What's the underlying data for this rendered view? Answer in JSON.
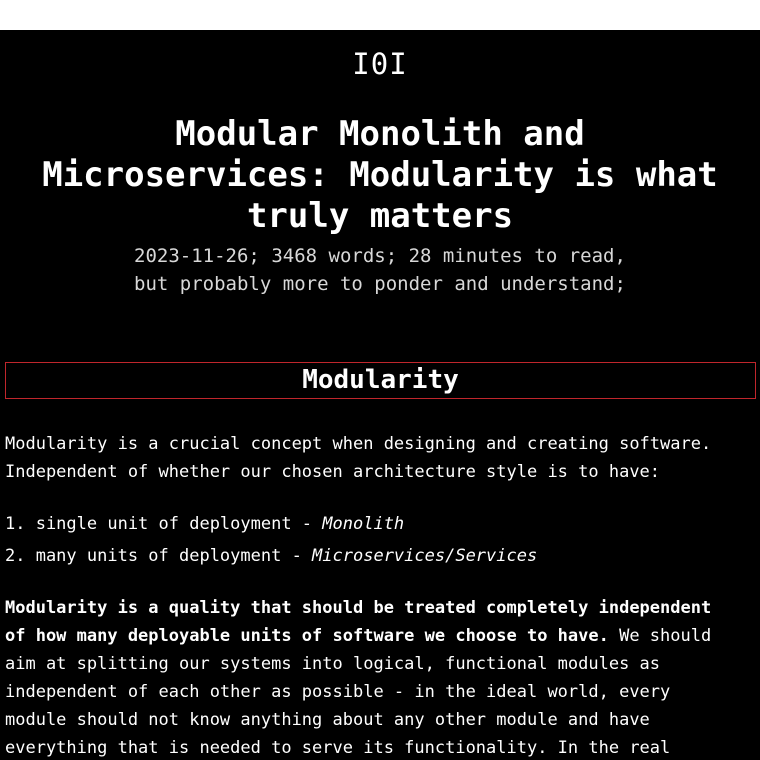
{
  "site": {
    "logo": "I0I"
  },
  "article": {
    "title_lines": [
      "Modular Monolith and",
      "Microservices: Modularity is what",
      "truly matters"
    ],
    "meta_line1": "2023-11-26; 3468 words; 28 minutes to read,",
    "meta_line2": "but probably more to ponder and understand;",
    "section_heading": "Modularity",
    "p1_line1": "Modularity is a crucial concept when designing and creating software.",
    "p1_line2": "Independent of whether our chosen architecture style is to have:",
    "list": [
      {
        "text": "1. single unit of deployment - ",
        "emphasis": "Monolith"
      },
      {
        "text": "2. many units of deployment - ",
        "emphasis": "Microservices/Services"
      }
    ],
    "p2_bold_line1": "Modularity is a quality that should be treated completely independent",
    "p2_bold_line2": "of how many deployable units of software we choose to have.",
    "p2_line2_rest": " We should",
    "p2_line3": "aim at splitting our systems into logical, functional modules as",
    "p2_line4": "independent of each other as possible - in the ideal world, every",
    "p2_line5": "module should not know anything about any other module and have",
    "p2_line6": "everything that is needed to serve its functionality. In the real"
  }
}
